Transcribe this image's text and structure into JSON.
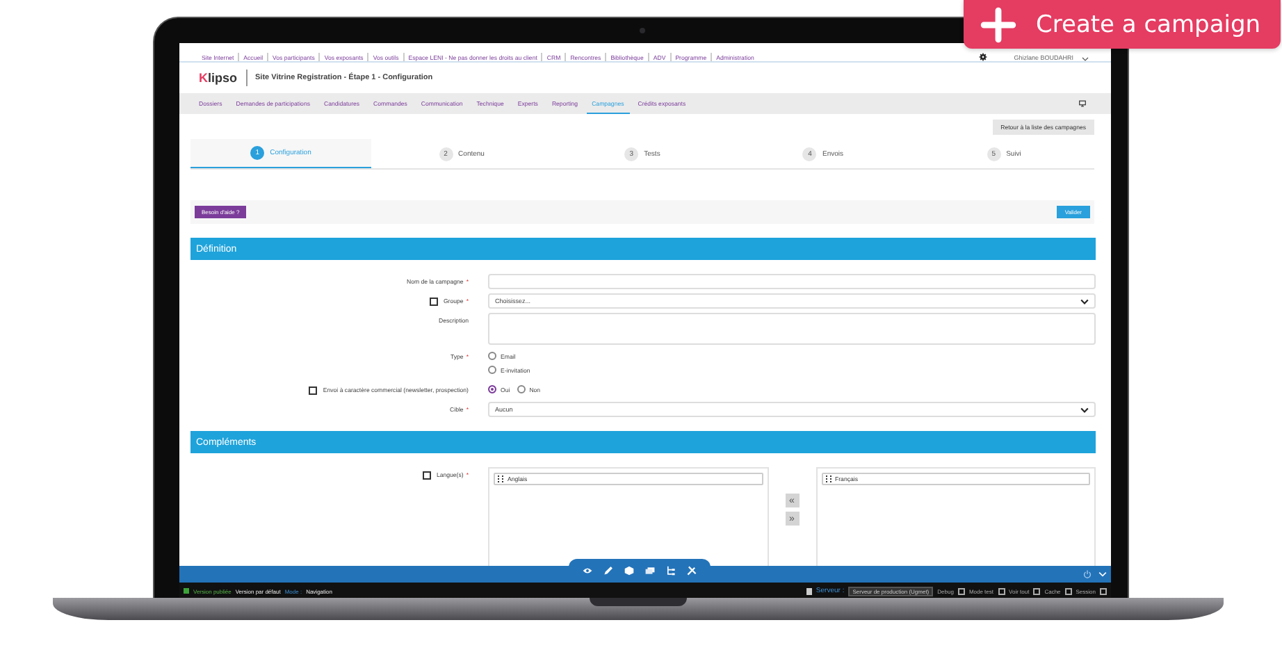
{
  "create_button": {
    "label": "Create a campaign"
  },
  "top_links": [
    "Site Internet",
    "Accueil",
    "Vos participants",
    "Vos exposants",
    "Vos outils",
    "Espace LENI - Ne pas donner les droits au client",
    "CRM",
    "Rencontres",
    "Bibliothèque",
    "ADV",
    "Programme",
    "Administration"
  ],
  "user": {
    "name": "Ghizlane BOUDAHRI"
  },
  "header": {
    "logo_first": "K",
    "logo_rest": "lipso",
    "title": "Site Vitrine Registration - Étape 1 - Configuration"
  },
  "nav_tabs": [
    {
      "label": "Dossiers",
      "selected": false
    },
    {
      "label": "Demandes de participations",
      "selected": false
    },
    {
      "label": "Candidatures",
      "selected": false
    },
    {
      "label": "Commandes",
      "selected": false
    },
    {
      "label": "Communication",
      "selected": false
    },
    {
      "label": "Technique",
      "selected": false
    },
    {
      "label": "Experts",
      "selected": false
    },
    {
      "label": "Reporting",
      "selected": false
    },
    {
      "label": "Campagnes",
      "selected": true
    },
    {
      "label": "Crédits exposants",
      "selected": false
    }
  ],
  "back_button": "Retour à la liste des campagnes",
  "steps": [
    {
      "number": "1",
      "label": "Configuration",
      "selected": true
    },
    {
      "number": "2",
      "label": "Contenu",
      "selected": false
    },
    {
      "number": "3",
      "label": "Tests",
      "selected": false
    },
    {
      "number": "4",
      "label": "Envois",
      "selected": false
    },
    {
      "number": "5",
      "label": "Suivi",
      "selected": false
    }
  ],
  "help_button": "Besoin d'aide ?",
  "validate_button": "Valider",
  "definition_title": "Définition",
  "fields": [
    {
      "kind": "text",
      "label": "Nom de la campagne",
      "mark": "*",
      "info": false
    },
    {
      "kind": "select",
      "label": "Groupe",
      "mark": "*",
      "info": true,
      "value": "Choisissez..."
    },
    {
      "kind": "textarea",
      "label": "Description",
      "info": false
    },
    {
      "kind": "radio-stack",
      "label": "Type",
      "mark": "*",
      "info": false,
      "options": [
        {
          "label": "Email",
          "selected": false
        },
        {
          "label": "E-invitation",
          "selected": false
        }
      ]
    },
    {
      "kind": "radio-row",
      "label": "Envoi à caractère commercial (newsletter, prospection)",
      "info": true,
      "options": [
        {
          "label": "Oui",
          "selected": true
        },
        {
          "label": "Non",
          "selected": false
        }
      ]
    },
    {
      "kind": "select",
      "label": "Cible",
      "mark": "*",
      "info": false,
      "value": "Aucun"
    }
  ],
  "complements_title": "Compléments",
  "languages": {
    "label": "Langue(s)",
    "mark": "*",
    "info": true,
    "available": [
      "Anglais"
    ],
    "chosen": [
      "Français"
    ],
    "move_left": "«",
    "move_right": "»"
  },
  "status_bar": {
    "version": "Version publiée",
    "default": "Version par défaut",
    "mode_label": "Mode :",
    "mode": "Navigation",
    "server_label": "Serveur :",
    "server": "Serveur de production (Ugmet)",
    "toggles": [
      {
        "label": "Debug",
        "checked": false
      },
      {
        "label": "Mode test",
        "checked": false
      },
      {
        "label": "Voir tout",
        "checked": false
      },
      {
        "label": "Cache",
        "checked": false
      },
      {
        "label": "Session",
        "checked": false
      }
    ]
  }
}
